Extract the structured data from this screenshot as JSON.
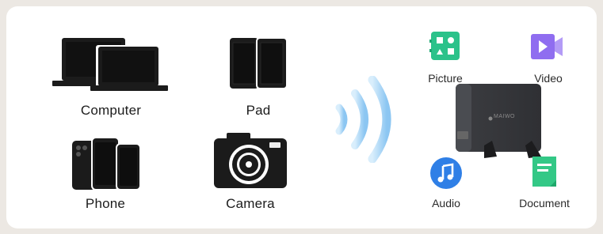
{
  "devices": {
    "computer": {
      "label": "Computer",
      "icon": "laptops-icon"
    },
    "pad": {
      "label": "Pad",
      "icon": "tablets-icon"
    },
    "phone": {
      "label": "Phone",
      "icon": "phones-icon"
    },
    "camera": {
      "label": "Camera",
      "icon": "camera-icon"
    }
  },
  "files": {
    "picture": {
      "label": "Picture",
      "icon": "picture-icon",
      "color": "#2bc28a"
    },
    "video": {
      "label": "Video",
      "icon": "video-icon",
      "color": "#8f6df0"
    },
    "audio": {
      "label": "Audio",
      "icon": "music-note-icon",
      "color": "#2f7fe6"
    },
    "document": {
      "label": "Document",
      "icon": "document-icon",
      "color": "#33c886"
    }
  },
  "enclosure": {
    "brand": "MAIWO"
  },
  "colors": {
    "wifi": "#9fd0f5",
    "drive": "#3a3b3f"
  }
}
